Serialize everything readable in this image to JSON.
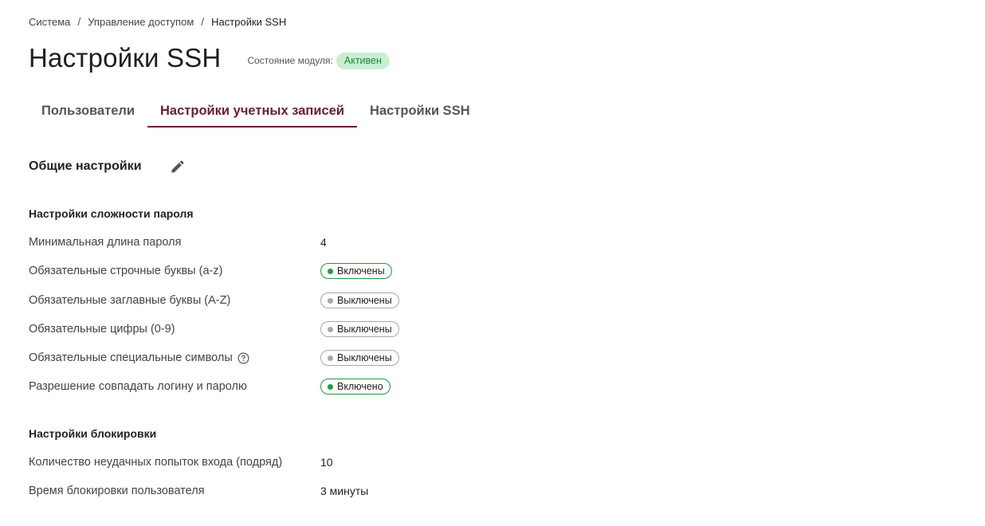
{
  "breadcrumb": {
    "items": [
      "Система",
      "Управление доступом",
      "Настройки SSH"
    ],
    "separator": "/"
  },
  "header": {
    "title": "Настройки SSH",
    "module_state_label": "Состояние модуля:",
    "module_state_value": "Активен"
  },
  "tabs": [
    {
      "label": "Пользователи",
      "active": false
    },
    {
      "label": "Настройки учетных записей",
      "active": true
    },
    {
      "label": "Настройки SSH",
      "active": false
    }
  ],
  "section": {
    "title": "Общие настройки",
    "edit_icon": "pencil-icon"
  },
  "password_complexity": {
    "title": "Настройки сложности пароля",
    "rows": [
      {
        "label": "Минимальная длина пароля",
        "value": "4"
      },
      {
        "label": "Обязательные строчные буквы (a-z)",
        "value": "Включены",
        "state": "on"
      },
      {
        "label": "Обязательные заглавные буквы (A-Z)",
        "value": "Выключены",
        "state": "off"
      },
      {
        "label": "Обязательные цифры (0-9)",
        "value": "Выключены",
        "state": "off"
      },
      {
        "label": "Обязательные специальные символы",
        "value": "Выключены",
        "state": "off",
        "help_icon": "question-circle-icon"
      },
      {
        "label": "Разрешение совпадать логину и паролю",
        "value": "Включено",
        "state": "on"
      }
    ]
  },
  "lockout": {
    "title": "Настройки блокировки",
    "rows": [
      {
        "label": "Количество неудачных попыток входа (подряд)",
        "value": "10"
      },
      {
        "label": "Время блокировки пользователя",
        "value": "3 минуты"
      }
    ]
  },
  "colors": {
    "accent": "#6d1c36",
    "status_active_bg": "#c9efd1",
    "status_active_text": "#1f8a3a",
    "enabled": "#19a33a",
    "disabled": "#a8a8a8"
  }
}
